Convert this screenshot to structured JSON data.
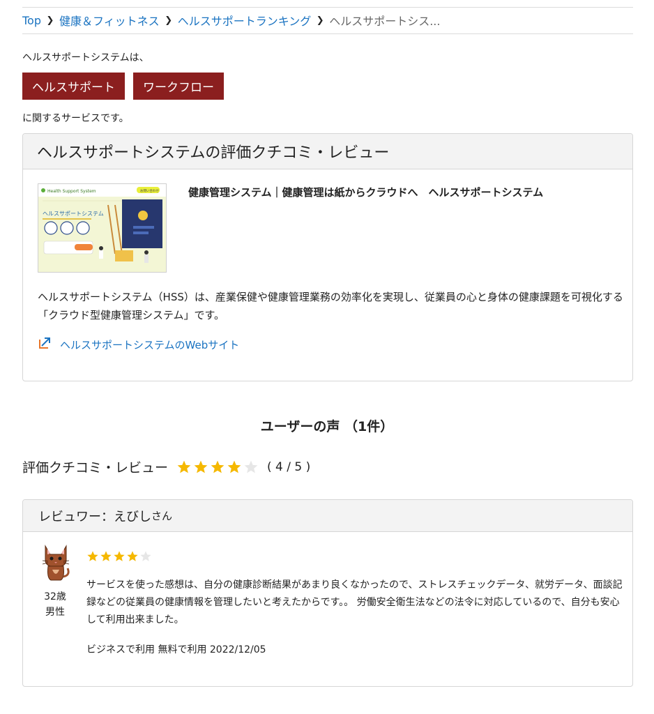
{
  "breadcrumb": {
    "items": [
      "Top",
      "健康＆フィットネス",
      "ヘルスサポートランキング"
    ],
    "current": "ヘルスサポートシス..."
  },
  "intro": {
    "before": "ヘルスサポートシステムは、",
    "tags": [
      "ヘルスサポート",
      "ワークフロー"
    ],
    "after": "に関するサービスです。"
  },
  "product": {
    "card_title": "ヘルスサポートシステムの評価クチコミ・レビュー",
    "title": "健康管理システム｜健康管理は紙からクラウドへ　ヘルスサポートシステム",
    "description": "ヘルスサポートシステム（HSS）は、産業保健や健康管理業務の効率化を実現し、従業員の心と身体の健康課題を可視化する「クラウド型健康管理システム」です。",
    "website_link": "ヘルスサポートシステムのWebサイト",
    "thumbnail": {
      "header": "Health Support System",
      "headline": "ヘルスサポートシステム",
      "badge": "お問い合わせ"
    }
  },
  "voices": {
    "title": "ユーザーの声 （1件）"
  },
  "rating": {
    "label": "評価クチコミ・レビュー",
    "value": 4,
    "max": 5,
    "score_text": "( 4 / 5 )"
  },
  "review": {
    "reviewer_prefix": "レビュワー：",
    "reviewer_name": "えびし",
    "reviewer_suffix": "さん",
    "age": "32歳",
    "gender": "男性",
    "stars": 4,
    "text": "サービスを使った感想は、自分の健康診断結果があまり良くなかったので、ストレスチェックデータ、就労データ、面談記録などの従業員の健康情報を管理したいと考えたからです。。 労働安全衛生法などの法令に対応しているので、自分も安心して利用出来ました。",
    "meta": "ビジネスで利用 無料で利用 2022/12/05"
  },
  "colors": {
    "tag_bg": "#8b1f1f",
    "link": "#1a73c1",
    "star_on": "#f5b800",
    "star_off": "#e6e6e6",
    "external_icon": "#e8762b"
  }
}
